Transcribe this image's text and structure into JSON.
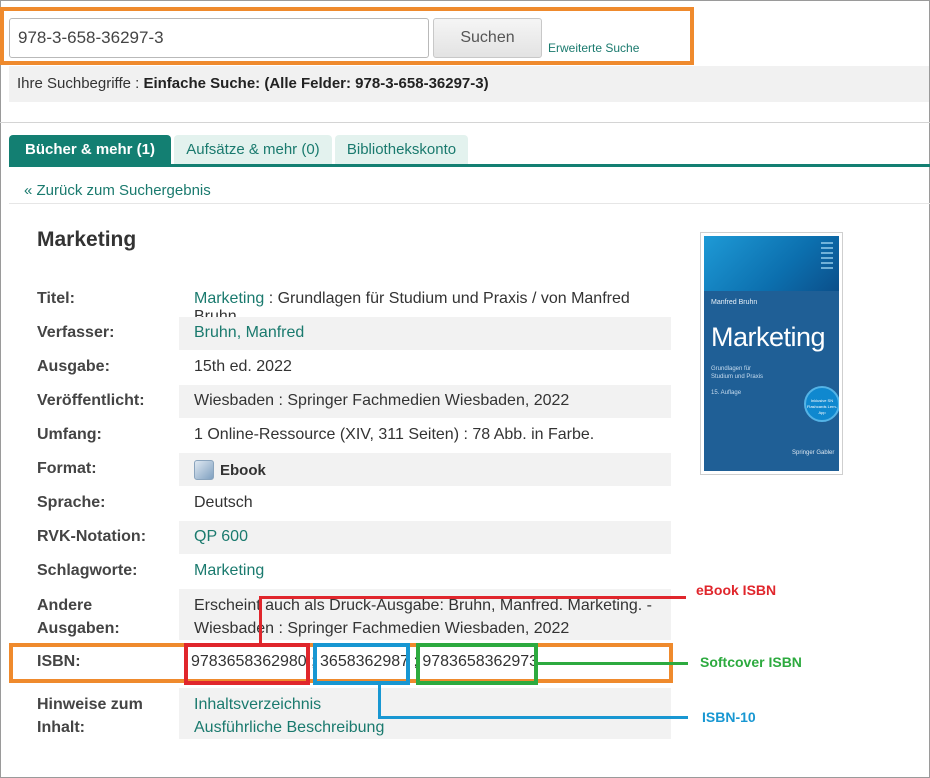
{
  "search": {
    "query": "978-3-658-36297-3",
    "button_label": "Suchen",
    "advanced_link": "Erweiterte Suche"
  },
  "search_terms": {
    "prefix": "Ihre Suchbegriffe : ",
    "value": "Einfache Suche: (Alle Felder: 978-3-658-36297-3)"
  },
  "tabs": [
    {
      "label": "Bücher & mehr (1)",
      "active": true
    },
    {
      "label": "Aufsätze & mehr (0)",
      "active": false
    },
    {
      "label": "Bibliothekskonto",
      "active": false
    }
  ],
  "back_link": "« Zurück zum Suchergebnis",
  "record": {
    "title": "Marketing",
    "fields": {
      "titel": {
        "label": "Titel:",
        "link": "Marketing",
        "rest": " : Grundlagen für Studium und Praxis / von Manfred Bruhn"
      },
      "verfasser": {
        "label": "Verfasser:",
        "value": "Bruhn, Manfred"
      },
      "ausgabe": {
        "label": "Ausgabe:",
        "value": "15th ed. 2022"
      },
      "veroeffentlicht": {
        "label": "Veröffentlicht:",
        "value": "Wiesbaden : Springer Fachmedien Wiesbaden, 2022"
      },
      "umfang": {
        "label": "Umfang:",
        "value": "1 Online-Ressource (XIV, 311 Seiten) : 78 Abb. in Farbe."
      },
      "format": {
        "label": "Format:",
        "value": "Ebook"
      },
      "sprache": {
        "label": "Sprache:",
        "value": "Deutsch"
      },
      "rvk": {
        "label": "RVK-Notation:",
        "value": "QP 600"
      },
      "schlagworte": {
        "label": "Schlagworte:",
        "value": "Marketing"
      },
      "andere": {
        "label_1": "Andere",
        "label_2": "Ausgaben:",
        "line_1": "Erscheint auch als Druck-Ausgabe: Bruhn, Manfred. Marketing. -",
        "line_2": "Wiesbaden : Springer Fachmedien Wiesbaden, 2022"
      },
      "isbn": {
        "label": "ISBN:",
        "isbn_1": "9783658362980",
        "sep": " ; ",
        "isbn_2": "3658362987",
        "isbn_3": "9783658362973"
      },
      "hinweise": {
        "label_1": "Hinweise zum",
        "label_2": "Inhalt:",
        "link_1": "Inhaltsverzeichnis",
        "link_2": "Ausführliche Beschreibung"
      }
    }
  },
  "cover": {
    "author": "Manfred Bruhn",
    "title": "Marketing",
    "subtitle": "Grundlagen für Studium und Praxis",
    "edition": "15. Auflage",
    "badge": "Inklusive SN Flashcards Lern-App",
    "publisher": "Springer Gabler"
  },
  "annotations": {
    "ebook": {
      "label": "eBook ISBN",
      "color": "#e0262c"
    },
    "softcover": {
      "label": "Softcover ISBN",
      "color": "#2daa3f"
    },
    "isbn10": {
      "label": "ISBN-10",
      "color": "#1897d2"
    },
    "highlight_color": "#ef8a2d"
  },
  "colors": {
    "accent": "#137f72",
    "link": "#1a7a6e"
  }
}
